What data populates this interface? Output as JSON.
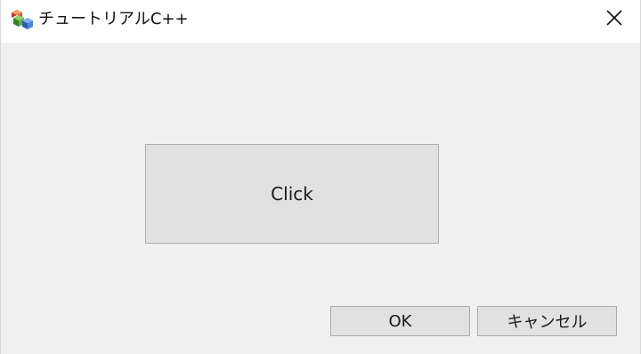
{
  "window": {
    "title": "チュートリアルC++",
    "icon": "app-icon",
    "close_icon": "close-icon"
  },
  "main": {
    "click_label": "Click",
    "ok_label": "OK",
    "cancel_label": "キャンセル"
  },
  "colors": {
    "client_background": "#f0f0f0",
    "titlebar_background": "#ffffff",
    "button_face": "#e1e1e1",
    "button_border": "#adadad"
  }
}
